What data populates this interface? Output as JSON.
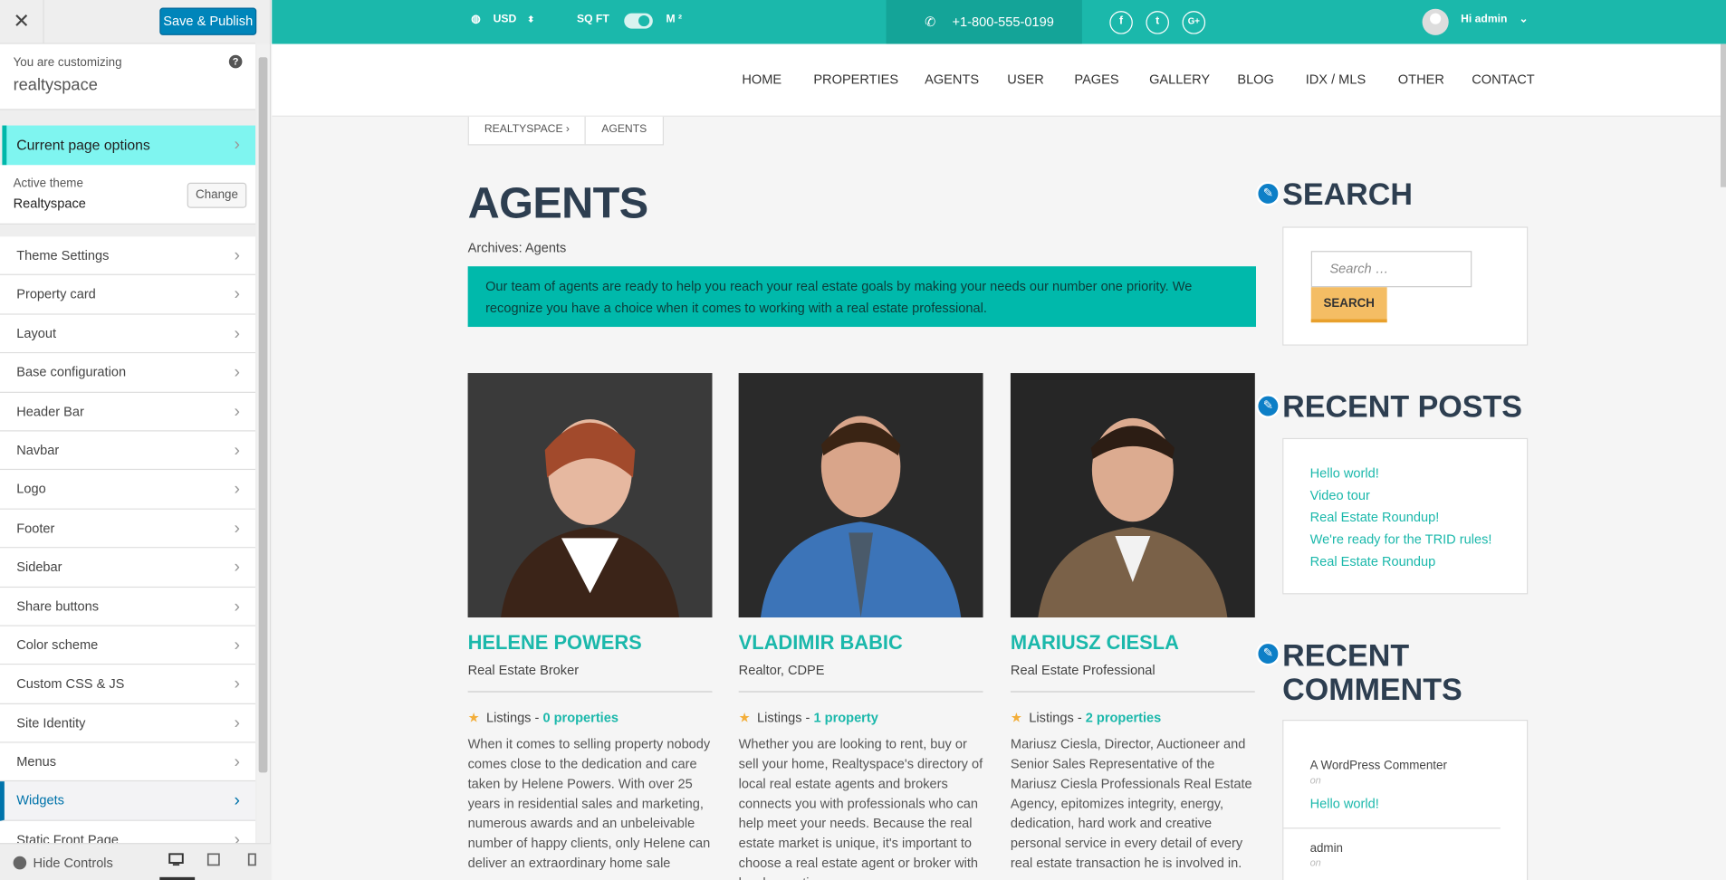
{
  "customizer": {
    "close_glyph": "✕",
    "save_label": "Save & Publish",
    "customizing_label": "You are customizing",
    "site_name": "realtyspace",
    "help_glyph": "?",
    "current_page_options": "Current page options",
    "active_theme_label": "Active theme",
    "active_theme_name": "Realtyspace",
    "change_label": "Change",
    "menu": [
      {
        "label": "Theme Settings"
      },
      {
        "label": "Property card"
      },
      {
        "label": "Layout"
      },
      {
        "label": "Base configuration"
      },
      {
        "label": "Header Bar"
      },
      {
        "label": "Navbar"
      },
      {
        "label": "Logo"
      },
      {
        "label": "Footer"
      },
      {
        "label": "Sidebar"
      },
      {
        "label": "Share buttons"
      },
      {
        "label": "Color scheme"
      },
      {
        "label": "Custom CSS & JS"
      },
      {
        "label": "Site Identity"
      },
      {
        "label": "Menus"
      },
      {
        "label": "Widgets"
      },
      {
        "label": "Static Front Page"
      }
    ],
    "hide_controls": "Hide Controls",
    "chevron": "›"
  },
  "topbar": {
    "currency": "USD",
    "unit_left": "SQ FT",
    "unit_right": "M ²",
    "phone": "+1-800-555-0199",
    "social": [
      "f",
      "t",
      "G+"
    ],
    "user_greeting": "Hi admin",
    "colors": {
      "bar": "#1bb8ab",
      "phone_bg": "#14a498"
    }
  },
  "nav": [
    "HOME",
    "PROPERTIES",
    "AGENTS",
    "USER",
    "PAGES",
    "GALLERY",
    "BLOG",
    "IDX / MLS",
    "OTHER",
    "CONTACT"
  ],
  "breadcrumb": [
    "REALTYSPACE  ›",
    "AGENTS"
  ],
  "page": {
    "title": "AGENTS",
    "archives": "Archives: Agents",
    "intro": "Our team of agents are ready to help you reach your real estate goals by making your needs our number one priority. We recognize you have a choice when it comes to working with a real estate professional."
  },
  "agents": [
    {
      "name": "HELENE POWERS",
      "role": "Real Estate Broker",
      "listings_label": "Listings -",
      "listings_count": "0 properties",
      "bio": "When it comes to selling property nobody comes close to the dedication and care taken by Helene Powers. With over 25 years in residential sales and marketing, numerous awards and an unbeleivable number of happy clients, only Helene can deliver an extraordinary home sale"
    },
    {
      "name": "VLADIMIR BABIC",
      "role": "Realtor, CDPE",
      "listings_label": "Listings -",
      "listings_count": "1 property",
      "bio": "Whether you are looking to rent, buy or sell your home, Realtyspace's directory of local real estate agents and brokers connects you with professionals who can help meet your needs. Because the real estate market is unique, it's important to choose a real estate agent or broker with local expertise"
    },
    {
      "name": "MARIUSZ CIESLA",
      "role": "Real Estate Professional",
      "listings_label": "Listings -",
      "listings_count": "2 properties",
      "bio": "Mariusz Ciesla, Director, Auctioneer and Senior Sales Representative of the Mariusz Ciesla Professionals Real Estate Agency, epitomizes integrity, energy, dedication, hard work and creative personal service in every detail of every real estate transaction he is involved in."
    }
  ],
  "sidebar": {
    "search_title": "SEARCH",
    "search_placeholder": "Search …",
    "search_button": "SEARCH",
    "recent_posts_title": "RECENT POSTS",
    "recent_posts": [
      "Hello world!",
      "Video tour",
      "Real Estate Roundup!",
      "We're ready for the TRID rules!",
      "Real Estate Roundup"
    ],
    "recent_comments_title_1": "RECENT",
    "recent_comments_title_2": "COMMENTS",
    "comments": [
      {
        "author": "A WordPress Commenter",
        "on": "on",
        "post": "Hello world!"
      },
      {
        "author": "admin",
        "on": "on"
      }
    ]
  }
}
